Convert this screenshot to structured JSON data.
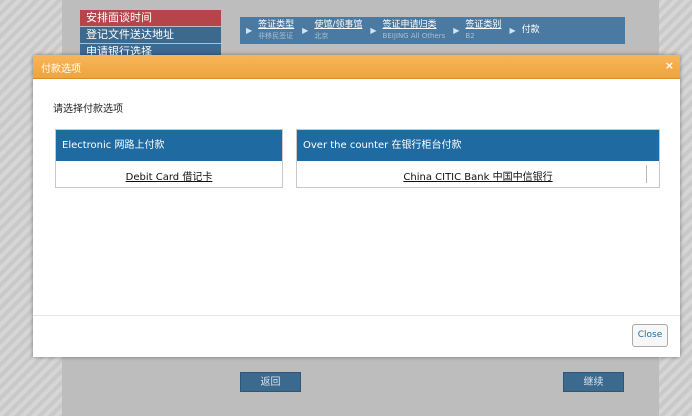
{
  "sidebar": {
    "items": [
      {
        "label": "安排面谈时间"
      },
      {
        "label": "登记文件送达地址"
      },
      {
        "label": "申请银行选择"
      }
    ]
  },
  "breadcrumb": {
    "items": [
      {
        "label": "签证类型",
        "sub": "非移民签证"
      },
      {
        "label": "使馆/领事馆",
        "sub": "北京"
      },
      {
        "label": "签证申请归类",
        "sub": "BEIJING All Others"
      },
      {
        "label": "签证类别",
        "sub": "B2"
      },
      {
        "label": "付款",
        "sub": ""
      }
    ]
  },
  "background_buttons": {
    "back": "返回",
    "continue": "继续"
  },
  "modal": {
    "title": "付款选项",
    "close_icon": "×",
    "prompt": "请选择付款选项",
    "options": [
      {
        "header": "Electronic 网路上付款",
        "link": "Debit Card 借记卡"
      },
      {
        "header": "Over the counter 在银行柜台付款",
        "link": "China CITIC Bank 中国中信银行"
      }
    ],
    "close_button": "Close"
  },
  "colors": {
    "modal_header": "#f0a43c",
    "panel_header": "#1f6aa0",
    "breadcrumb_bg": "#4a7aa1",
    "sidebar_active": "#b5454b"
  }
}
